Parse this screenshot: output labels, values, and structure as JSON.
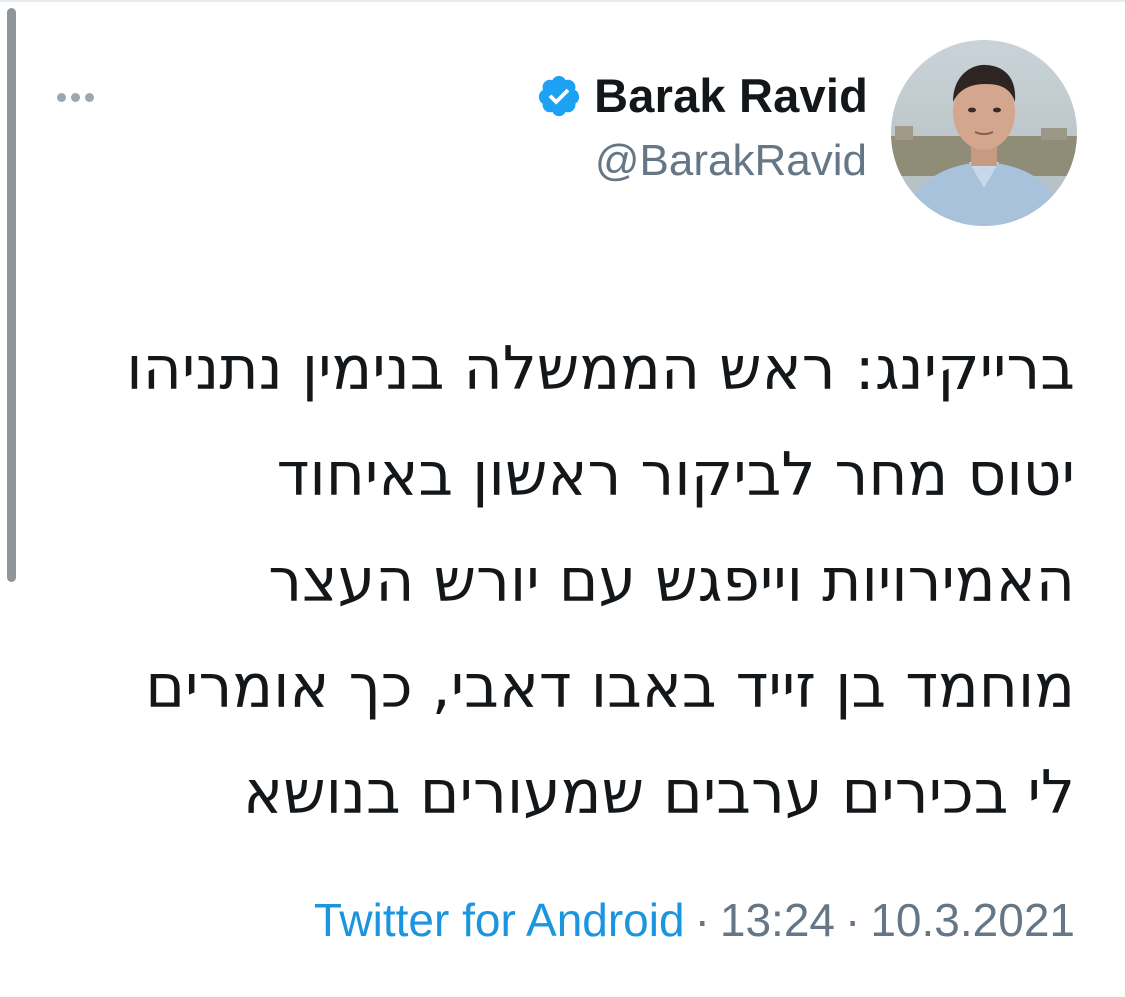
{
  "tweet": {
    "author": {
      "display_name": "Barak Ravid",
      "handle": "@BarakRavid",
      "verified": true,
      "verified_icon": "verified-badge-icon",
      "verified_color": "#1da1f2"
    },
    "text_lines": [
      "ברייקינג: ראש הממשלה בנימין נתניהו",
      "יטוס מחר לביקור ראשון באיחוד",
      "האמירויות וייפגש עם יורש העצר",
      "מוחמד בן זייד באבו דאבי, כך אומרים",
      "לי בכירים ערבים שמעורים בנושא"
    ],
    "source": "Twitter for Android",
    "separator": "·",
    "time": "13:24",
    "date": "10.3.2021"
  },
  "menu": {
    "icon": "more-horizontal-icon"
  },
  "colors": {
    "text_primary": "#14171a",
    "text_secondary": "#657786",
    "link": "#1b95e0"
  }
}
